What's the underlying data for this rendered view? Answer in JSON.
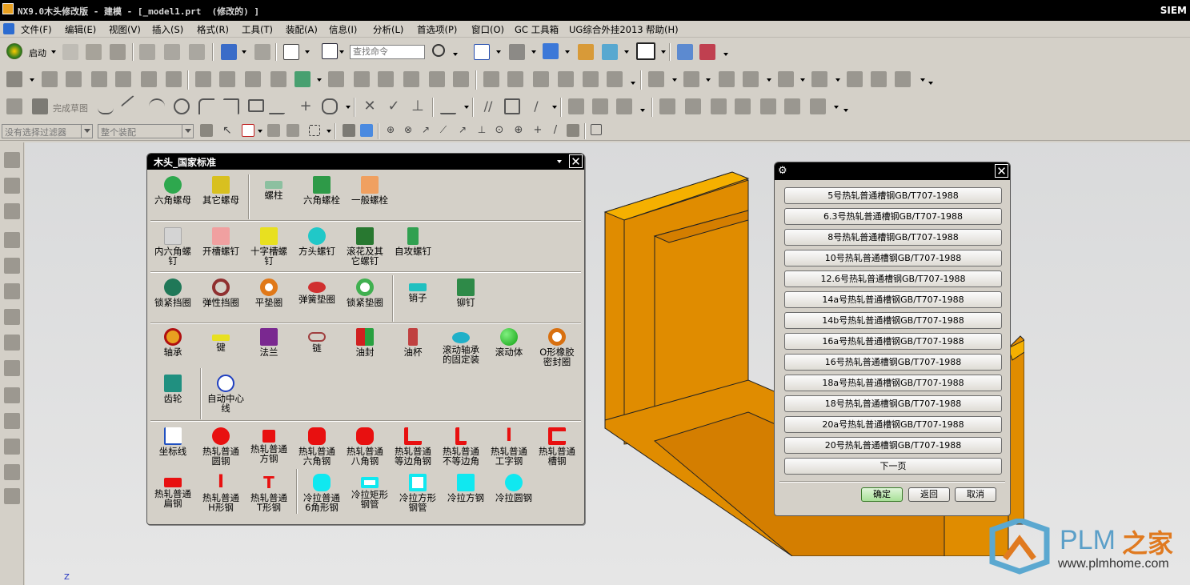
{
  "window": {
    "title": "NX9.0木头修改版 - 建模 - [_model1.prt  (修改的) ]",
    "brand": "SIEM"
  },
  "menu": [
    "文件(F)",
    "编辑(E)",
    "视图(V)",
    "插入(S)",
    "格式(R)",
    "工具(T)",
    "装配(A)",
    "信息(I)",
    "分析(L)",
    "首选项(P)",
    "窗口(O)",
    "GC 工具箱",
    "UG综合外挂2013",
    "帮助(H)"
  ],
  "toolbar": {
    "start_label": "启动",
    "search_placeholder": "查找命令",
    "finish_sketch": "完成草图"
  },
  "selection": {
    "filter": "没有选择过滤器",
    "scope": "整个装配"
  },
  "left_dialog": {
    "title": "木头_国家标准",
    "row1": [
      "六角螺母",
      "其它螺母",
      "螺柱",
      "六角螺栓",
      "一般螺栓"
    ],
    "row2": [
      "内六角螺钉",
      "开槽螺钉",
      "十字槽螺钉",
      "方头螺钉",
      "滚花及其它螺钉",
      "自攻螺钉"
    ],
    "row3": [
      "锁紧挡圈",
      "弹性挡圈",
      "平垫圈",
      "弹簧垫圈",
      "锁紧垫圈",
      "销子",
      "铆钉"
    ],
    "row4": [
      "轴承",
      "键",
      "法兰",
      "链",
      "油封",
      "油杯",
      "滚动轴承的固定装",
      "滚动体",
      "O形橡胶密封圈"
    ],
    "row5": [
      "齿轮",
      "自动中心线"
    ],
    "row6": [
      "坐标线",
      "热轧普通圆钢",
      "热轧普通方钢",
      "热轧普通六角钢",
      "热轧普通八角钢",
      "热轧普通等边角钢",
      "热轧普通不等边角",
      "热轧普通工字钢",
      "热轧普通槽钢"
    ],
    "row7": [
      "热轧普通扁钢",
      "热轧普通H形钢",
      "热轧普通T形钢",
      "冷拉普通6角形钢",
      "冷拉矩形钢管",
      "冷拉方形钢管",
      "冷拉方钢",
      "冷拉圆钢"
    ]
  },
  "right_dialog": {
    "items": [
      "5号热轧普通槽钢GB/T707-1988",
      "6.3号热轧普通槽钢GB/T707-1988",
      "8号热轧普通槽钢GB/T707-1988",
      "10号热轧普通槽钢GB/T707-1988",
      "12.6号热轧普通槽钢GB/T707-1988",
      "14a号热轧普通槽钢GB/T707-1988",
      "14b号热轧普通槽钢GB/T707-1988",
      "16a号热轧普通槽钢GB/T707-1988",
      "16号热轧普通槽钢GB/T707-1988",
      "18a号热轧普通槽钢GB/T707-1988",
      "18号热轧普通槽钢GB/T707-1988",
      "20a号热轧普通槽钢GB/T707-1988",
      "20号热轧普通槽钢GB/T707-1988"
    ],
    "next_page": "下一页",
    "ok": "确定",
    "back": "返回",
    "cancel": "取消"
  },
  "watermark": {
    "name": "PLM",
    "cn": "之家",
    "url": "www.plmhome.com"
  },
  "axis_label": "Z",
  "colors": {
    "model": "#e08c00",
    "model_top": "#f5b000",
    "viewport": "#dcdcdc"
  }
}
